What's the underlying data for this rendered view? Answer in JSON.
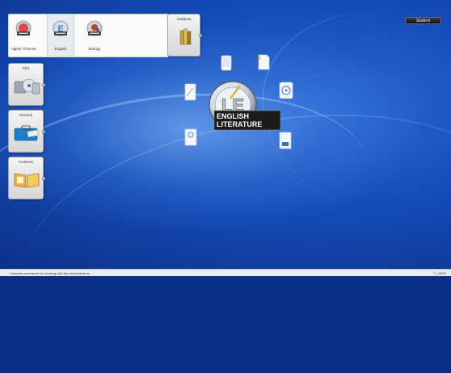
{
  "subjects": {
    "items": [
      {
        "label": "Higher Chinese"
      },
      {
        "label": "English"
      },
      {
        "label": "Biology"
      }
    ]
  },
  "tabs": {
    "subjects": "Subjects",
    "cds": "CDs",
    "general": "General",
    "contents": "Contents"
  },
  "center": {
    "line1": "ENGLISH",
    "line2": "LITERATURE",
    "monogram": "LE"
  },
  "header": {
    "user_button": "Student"
  },
  "statusbar": {
    "text": "Contains commands for working with the selected items.",
    "zoom": "100%"
  }
}
